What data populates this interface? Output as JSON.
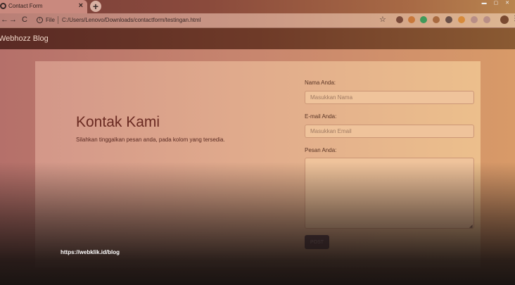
{
  "browser": {
    "tab_title": "Contact Form",
    "tab_close": "×",
    "new_tab": "+",
    "back_glyph": "←",
    "forward_glyph": "→",
    "reload_glyph": "C",
    "info_glyph": "i",
    "scheme": "File",
    "url": "C:/Users/Lenovo/Downloads/contactform/testingan.html",
    "star_glyph": "☆",
    "menu_glyph": "⋮",
    "extension_colors": [
      "#7a4a3a",
      "#c8783a",
      "#3f9a5a",
      "#a86a40",
      "#6a5048",
      "#d68a3a",
      "#b88e86",
      "#b88e86"
    ]
  },
  "navbar": {
    "brand": "Webhozz Blog"
  },
  "main": {
    "title": "Kontak Kami",
    "subtitle": "Silahkan tinggalkan pesan anda, pada kolom yang tersedia."
  },
  "form": {
    "name_label": "Nama Anda:",
    "name_placeholder": "Masukkan Nama",
    "email_label": "E-mail Anda:",
    "email_placeholder": "Masukkan Email",
    "message_label": "Pesan Anda:",
    "submit_label": "POST"
  },
  "watermark": "https://webklik.id/blog"
}
